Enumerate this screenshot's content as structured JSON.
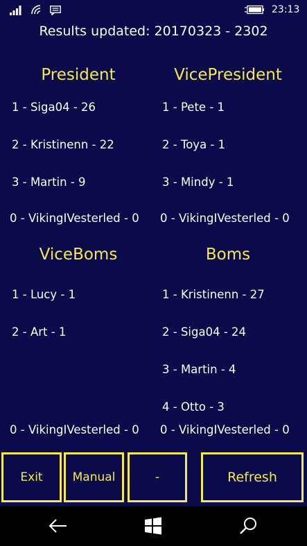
{
  "status": {
    "time": "23:13"
  },
  "header": {
    "title": "Results updated: 20170323 - 2302"
  },
  "sections": {
    "president": {
      "heading": "President",
      "entries": [
        "1 - Siga04 - 26",
        "2 - Kristinenn - 22",
        "3 - Martin - 9",
        "0 - VikingIVesterled - 0"
      ]
    },
    "vicepresident": {
      "heading": "VicePresident",
      "entries": [
        "1 - Pete - 1",
        "2 - Toya - 1",
        "3 - Mindy - 1",
        "0 - VikingIVesterled - 0"
      ]
    },
    "viceboms": {
      "heading": "ViceBoms",
      "entries": [
        "1 - Lucy - 1",
        "2 - Art - 1",
        "0 - VikingIVesterled - 0"
      ]
    },
    "boms": {
      "heading": "Boms",
      "entries": [
        "1 - Kristinenn - 27",
        "2 - Siga04 - 24",
        "3 - Martin - 4",
        "4 - Otto - 3",
        "0 - VikingIVesterled - 0"
      ]
    }
  },
  "buttons": {
    "exit": "Exit",
    "manual": "Manual",
    "dash": "-",
    "refresh": "Refresh"
  },
  "icons": {
    "signal": "signal-icon",
    "wifi": "wifi-icon",
    "message": "message-icon",
    "battery": "battery-icon",
    "back": "back-icon",
    "windows": "windows-icon",
    "search": "search-icon"
  },
  "colors": {
    "background": "#0b0a4a",
    "accent": "#f5ea4a"
  }
}
